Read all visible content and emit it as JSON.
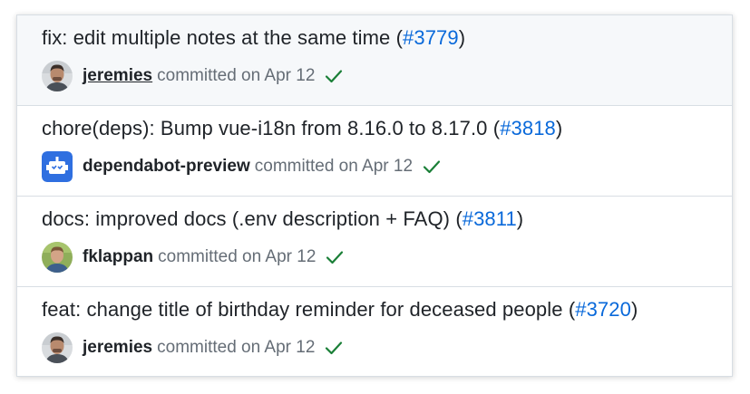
{
  "commits": [
    {
      "message": "fix: edit multiple notes at the same time",
      "pr": "#3779",
      "author": "jeremies",
      "committed_text": "committed on Apr 12",
      "avatar_icon": "user-photo-icon",
      "status_icon": "check-icon"
    },
    {
      "message": "chore(deps): Bump vue-i18n from 8.16.0 to 8.17.0",
      "pr": "#3818",
      "author": "dependabot-preview",
      "committed_text": "committed on Apr 12",
      "avatar_icon": "bot-icon",
      "status_icon": "check-icon"
    },
    {
      "message": "docs: improved docs (.env description + FAQ)",
      "pr": "#3811",
      "author": "fklappan",
      "committed_text": "committed on Apr 12",
      "avatar_icon": "user-photo-icon",
      "status_icon": "check-icon"
    },
    {
      "message": "feat: change title of birthday reminder for deceased people",
      "pr": "#3720",
      "author": "jeremies",
      "committed_text": "committed on Apr 12",
      "avatar_icon": "user-photo-icon",
      "status_icon": "check-icon"
    }
  ],
  "colors": {
    "link": "#0969da",
    "success": "#1a7f37",
    "bot_blue": "#2f6fe0"
  }
}
